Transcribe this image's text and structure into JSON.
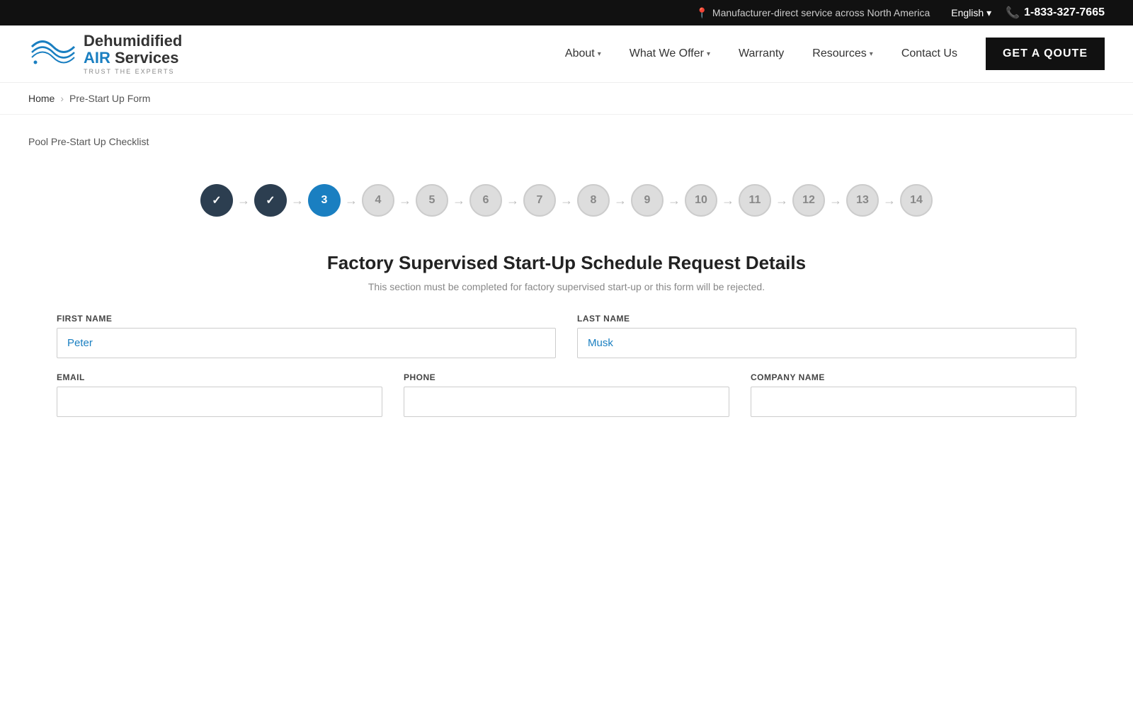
{
  "topbar": {
    "location_text": "Manufacturer-direct service across North America",
    "language": "English",
    "phone": "1-833-327-7665"
  },
  "header": {
    "logo_line1": "Dehumidified",
    "logo_line2_blue": "AIR",
    "logo_line2_dark": " Services",
    "logo_tagline": "TRUST THE EXPERTS",
    "nav": [
      {
        "label": "About",
        "has_dropdown": true
      },
      {
        "label": "What We Offer",
        "has_dropdown": true
      },
      {
        "label": "Warranty",
        "has_dropdown": false
      },
      {
        "label": "Resources",
        "has_dropdown": true
      },
      {
        "label": "Contact Us",
        "has_dropdown": false
      }
    ],
    "cta_button": "GET A QOUTE"
  },
  "breadcrumb": {
    "home": "Home",
    "current": "Pre-Start Up Form"
  },
  "page": {
    "label": "Pool Pre-Start Up Checklist"
  },
  "stepper": {
    "steps": [
      {
        "number": "1",
        "state": "completed"
      },
      {
        "number": "2",
        "state": "completed"
      },
      {
        "number": "3",
        "state": "active"
      },
      {
        "number": "4",
        "state": "inactive"
      },
      {
        "number": "5",
        "state": "inactive"
      },
      {
        "number": "6",
        "state": "inactive"
      },
      {
        "number": "7",
        "state": "inactive"
      },
      {
        "number": "8",
        "state": "inactive"
      },
      {
        "number": "9",
        "state": "inactive"
      },
      {
        "number": "10",
        "state": "inactive"
      },
      {
        "number": "11",
        "state": "inactive"
      },
      {
        "number": "12",
        "state": "inactive"
      },
      {
        "number": "13",
        "state": "inactive"
      },
      {
        "number": "14",
        "state": "inactive"
      }
    ]
  },
  "form": {
    "title": "Factory Supervised Start-Up Schedule Request Details",
    "subtitle": "This section must be completed for factory supervised start-up or this form will be rejected.",
    "fields": {
      "first_name_label": "FIRST NAME",
      "first_name_value": "Peter",
      "last_name_label": "LAST NAME",
      "last_name_value": "Musk",
      "email_label": "EMAIL",
      "email_placeholder": "",
      "phone_label": "PHONE",
      "phone_placeholder": "",
      "company_label": "COMPANY NAME",
      "company_placeholder": ""
    }
  }
}
